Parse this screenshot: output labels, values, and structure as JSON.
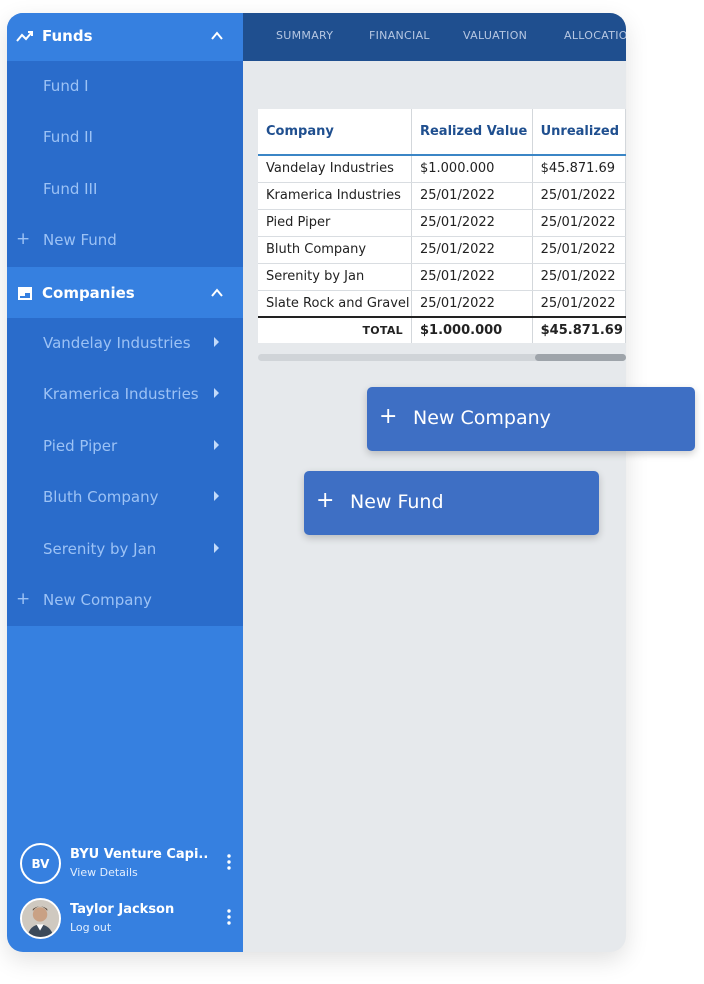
{
  "sidebar": {
    "funds": {
      "label": "Funds",
      "items": [
        "Fund I",
        "Fund II",
        "Fund III"
      ],
      "new_label": "New Fund"
    },
    "companies": {
      "label": "Companies",
      "items": [
        "Vandelay Industries",
        "Kramerica Industries",
        "Pied Piper",
        "Bluth Company",
        "Serenity by Jan"
      ],
      "new_label": "New Company"
    },
    "org": {
      "initials": "BV",
      "name": "BYU Venture Capi..",
      "sub": "View Details"
    },
    "user": {
      "name": "Taylor Jackson",
      "sub": "Log out"
    }
  },
  "tabs": [
    "SUMMARY",
    "FINANCIAL",
    "VALUATION",
    "ALLOCATIO"
  ],
  "table": {
    "headers": [
      "Company",
      "Realized Value",
      "Unrealized"
    ],
    "rows": [
      [
        "Vandelay Industries",
        "$1.000.000",
        "$45.871.69"
      ],
      [
        "Kramerica Industries",
        "25/01/2022",
        "25/01/2022"
      ],
      [
        "Pied Piper",
        "25/01/2022",
        "25/01/2022"
      ],
      [
        "Bluth Company",
        "25/01/2022",
        "25/01/2022"
      ],
      [
        "Serenity by Jan",
        "25/01/2022",
        "25/01/2022"
      ],
      [
        "Slate Rock and Gravel",
        "25/01/2022",
        "25/01/2022"
      ]
    ],
    "total_label": "TOTAL",
    "totals": [
      "$1.000.000",
      "$45.871.69"
    ]
  },
  "buttons": {
    "new_company": "New Company",
    "new_fund": "New Fund",
    "plus": "+"
  },
  "colors": {
    "sidebar": "#3680e0",
    "sidebar_group": "#2a6ccb",
    "topnav": "#1f4f8f",
    "button": "#3e6fc4",
    "content_bg": "#e6e9ec"
  }
}
